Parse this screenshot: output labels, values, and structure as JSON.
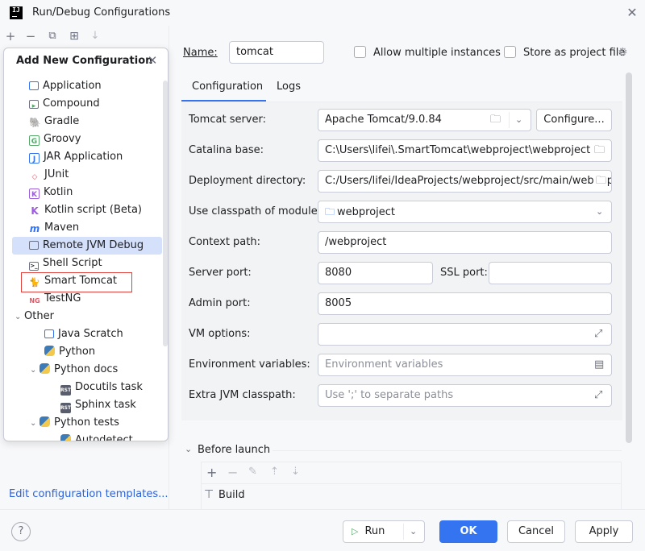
{
  "window": {
    "title": "Run/Debug Configurations",
    "app_icon_text": "IJ"
  },
  "toolbar": {
    "add": "+",
    "remove": "−",
    "copy": "⧉",
    "new_folder": "⊞",
    "sort": "↓"
  },
  "popup": {
    "title": "Add New Configuration",
    "items": [
      {
        "label": "Application",
        "icon": "application-icon",
        "color": "#3574f0"
      },
      {
        "label": "Compound",
        "icon": "compound-icon",
        "color": "#55a76a"
      },
      {
        "label": "Gradle",
        "icon": "gradle-icon",
        "color": "#6c707e"
      },
      {
        "label": "Groovy",
        "icon": "groovy-icon",
        "color": "#55a76a"
      },
      {
        "label": "JAR Application",
        "icon": "jar-icon",
        "color": "#3574f0"
      },
      {
        "label": "JUnit",
        "icon": "junit-icon",
        "color": "#e55765"
      },
      {
        "label": "Kotlin",
        "icon": "kotlin-icon",
        "color": "#9c5cdb"
      },
      {
        "label": "Kotlin script (Beta)",
        "icon": "kotlin-script-icon",
        "color": "#9c5cdb"
      },
      {
        "label": "Maven",
        "icon": "maven-icon",
        "color": "#3574f0"
      },
      {
        "label": "Remote JVM Debug",
        "icon": "remote-debug-icon",
        "color": "#6c707e"
      },
      {
        "label": "Shell Script",
        "icon": "shell-icon",
        "color": "#6c707e"
      },
      {
        "label": "Smart Tomcat",
        "icon": "tomcat-icon",
        "color": "#e0a030"
      },
      {
        "label": "TestNG",
        "icon": "testng-icon",
        "color": "#e55765"
      }
    ],
    "other": {
      "label": "Other",
      "children": [
        {
          "label": "Java Scratch",
          "icon": "java-scratch-icon"
        },
        {
          "label": "Python",
          "icon": "python-icon"
        },
        {
          "label": "Python docs",
          "icon": "python-docs-icon",
          "children": [
            {
              "label": "Docutils task",
              "icon": "rst-icon",
              "badge": "RST"
            },
            {
              "label": "Sphinx task",
              "icon": "rst-icon",
              "badge": "RST"
            }
          ]
        },
        {
          "label": "Python tests",
          "icon": "python-tests-icon",
          "children": [
            {
              "label": "Autodetect",
              "icon": "python-icon"
            }
          ]
        }
      ]
    }
  },
  "edit_templates": "Edit configuration templates...",
  "name_label": "Name:",
  "name_value": "tomcat",
  "allow_multiple": "Allow multiple instances",
  "store_project": "Store as project file",
  "tabs": [
    "Configuration",
    "Logs"
  ],
  "form": {
    "tomcat_server_label": "Tomcat server:",
    "tomcat_server_value": "Apache Tomcat/9.0.84",
    "configure_btn": "Configure...",
    "catalina_label": "Catalina base:",
    "catalina_value": "C:\\Users\\lifei\\.SmartTomcat\\webproject\\webproject",
    "deploy_label": "Deployment directory:",
    "deploy_value": "C:/Users/lifei/IdeaProjects/webproject/src/main/webapp",
    "classpath_label": "Use classpath of module:",
    "classpath_value": "webproject",
    "context_label": "Context path:",
    "context_value": "/webproject",
    "server_port_label": "Server port:",
    "server_port_value": "8080",
    "ssl_port_label": "SSL port:",
    "ssl_port_value": "",
    "admin_port_label": "Admin port:",
    "admin_port_value": "8005",
    "vm_label": "VM options:",
    "vm_value": "",
    "env_label": "Environment variables:",
    "env_placeholder": "Environment variables",
    "jvm_cp_label": "Extra JVM classpath:",
    "jvm_cp_placeholder": "Use ';' to separate paths"
  },
  "before_launch": {
    "label": "Before launch",
    "task": "Build"
  },
  "buttons": {
    "run": "Run",
    "ok": "OK",
    "cancel": "Cancel",
    "apply": "Apply",
    "help": "?"
  }
}
